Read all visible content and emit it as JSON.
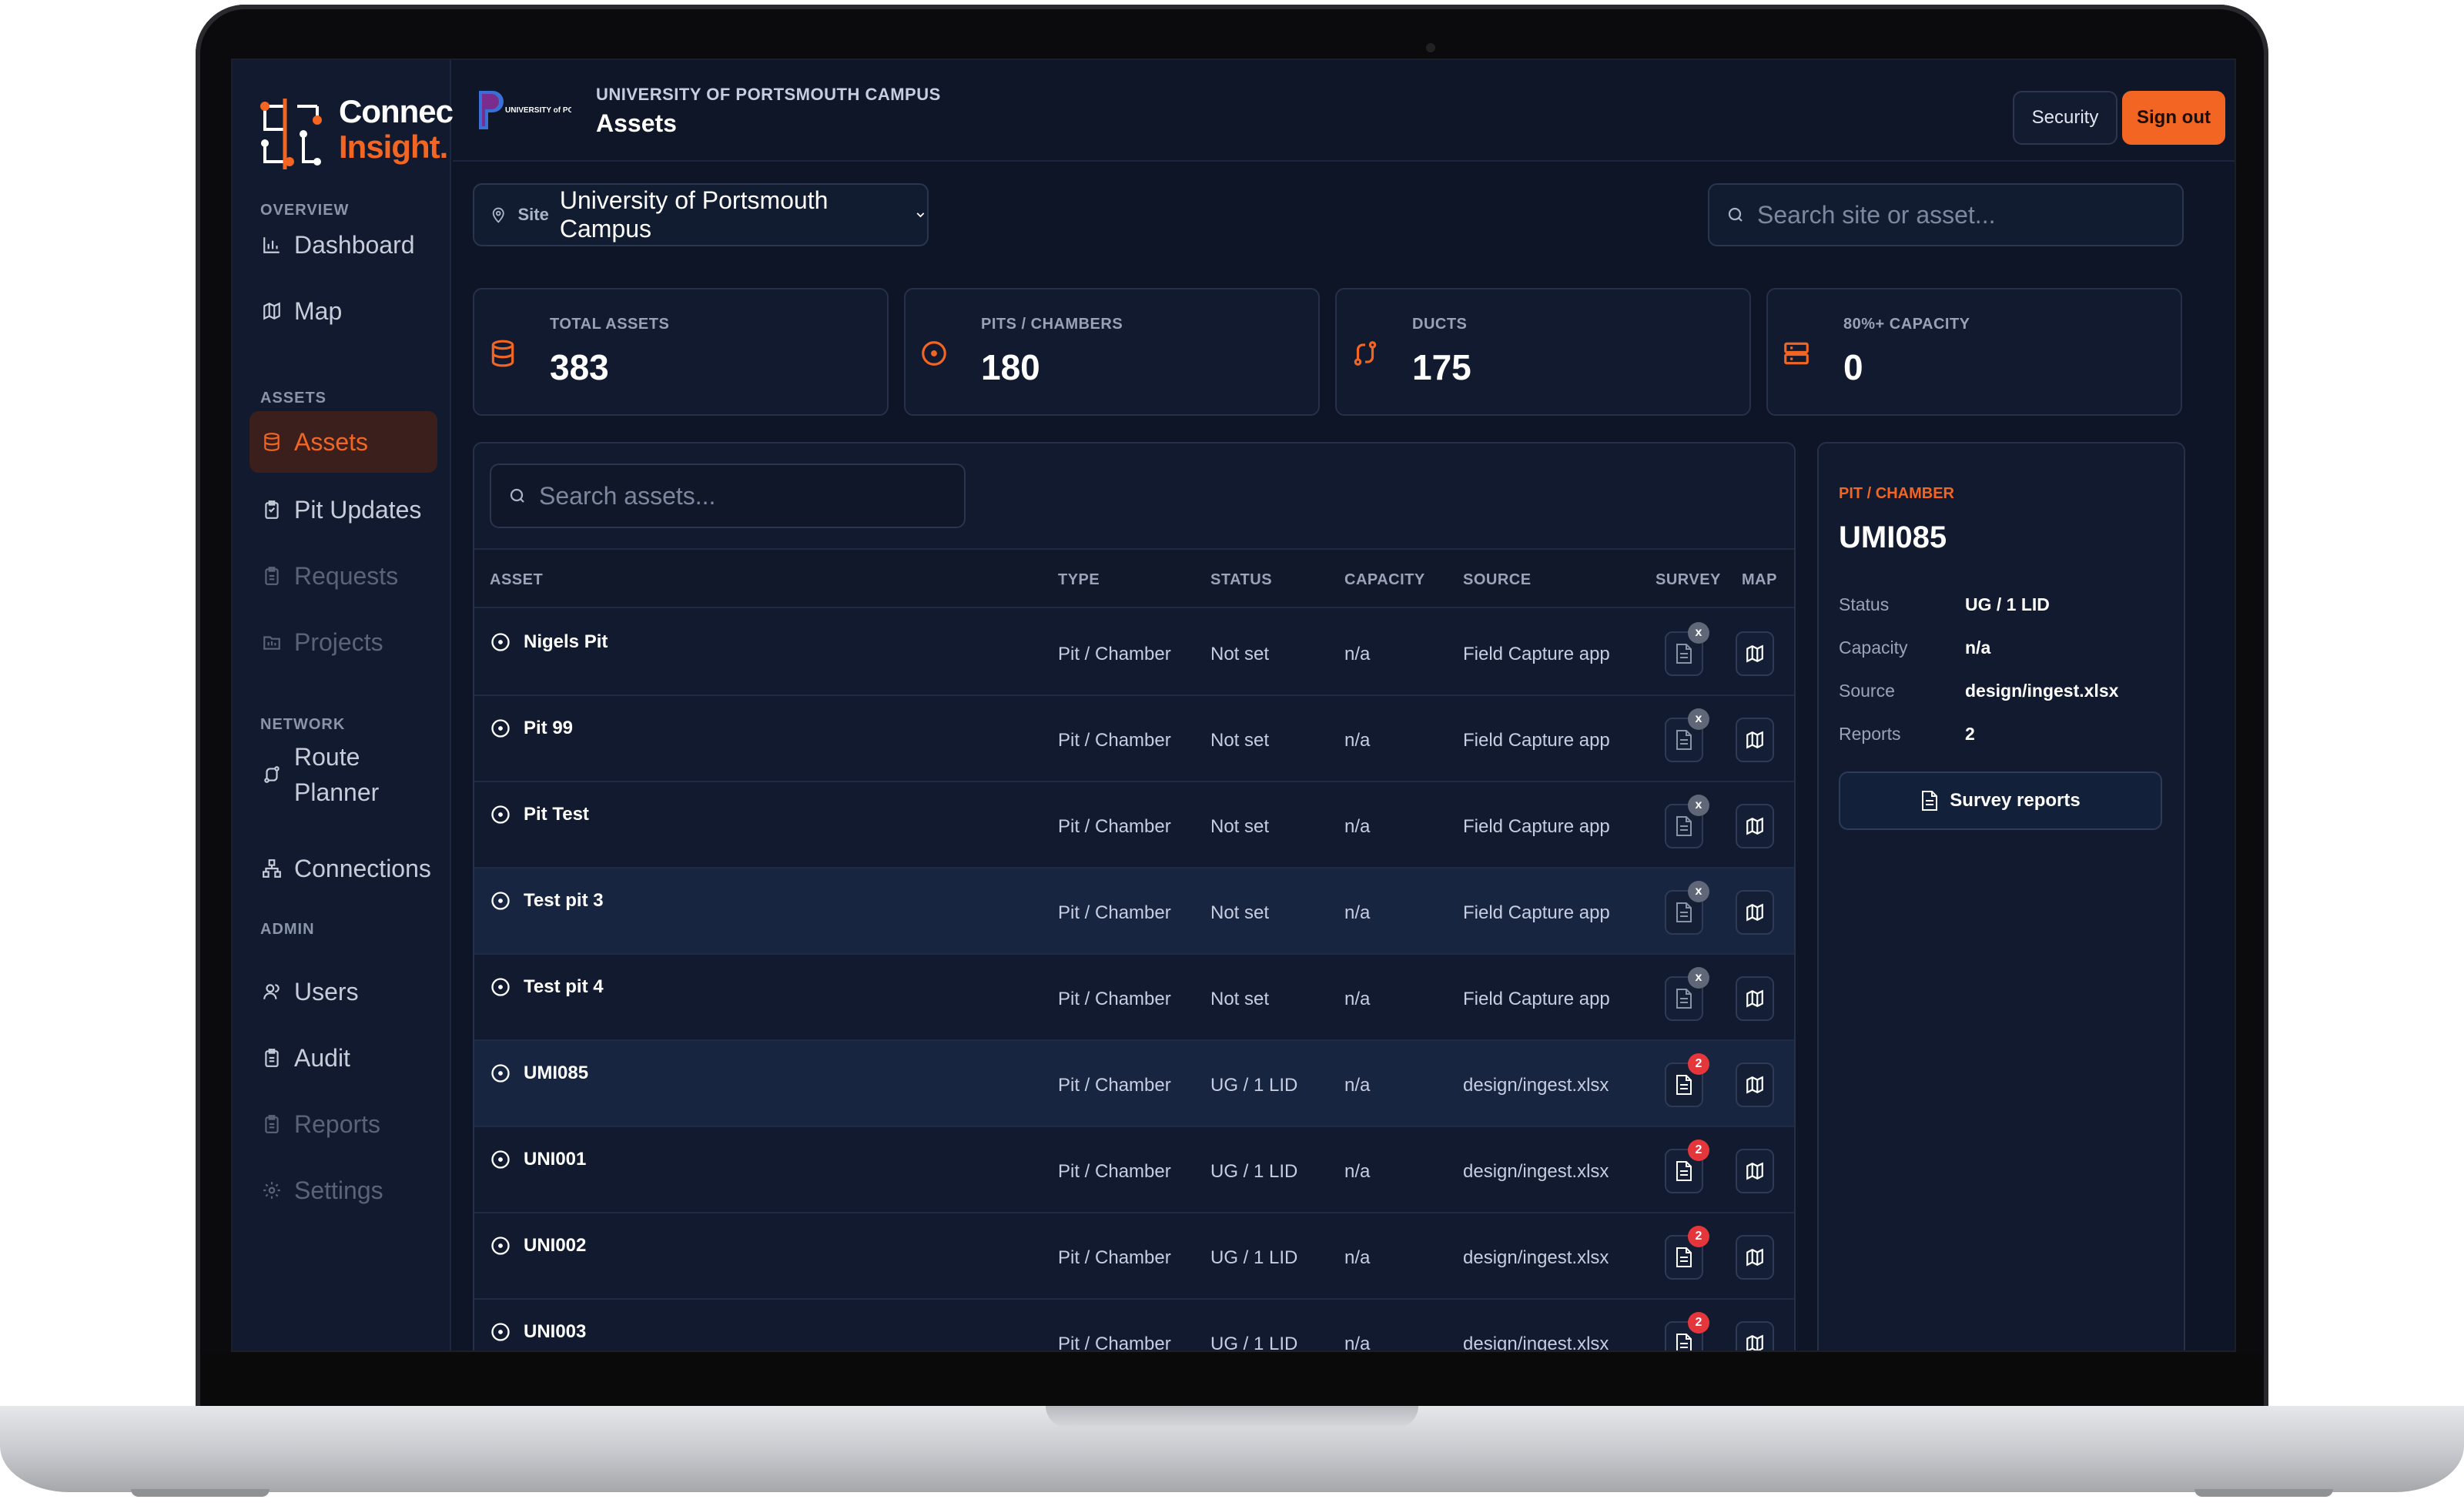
{
  "brand": {
    "line1": "Connect",
    "line2": "Insight."
  },
  "sidebar": {
    "sections": [
      "OVERVIEW",
      "ASSETS",
      "NETWORK",
      "ADMIN"
    ],
    "items": [
      {
        "label": "Dashboard",
        "icon": "bar-chart-icon"
      },
      {
        "label": "Map",
        "icon": "map-icon"
      },
      {
        "label": "Assets",
        "icon": "database-icon"
      },
      {
        "label": "Pit Updates",
        "icon": "clipboard-icon"
      },
      {
        "label": "Requests",
        "icon": "clipboard-icon"
      },
      {
        "label": "Projects",
        "icon": "folder-icon"
      },
      {
        "label": "Route",
        "label2": "Planner",
        "icon": "route-icon"
      },
      {
        "label": "Connections",
        "icon": "network-icon"
      },
      {
        "label": "Users",
        "icon": "user-icon"
      },
      {
        "label": "Audit",
        "icon": "clipboard-icon"
      },
      {
        "label": "Reports",
        "icon": "clipboard-icon"
      },
      {
        "label": "Settings",
        "icon": "gear-icon"
      }
    ]
  },
  "header": {
    "org_logo_text": "UNIVERSITY of PORTSMOUTH",
    "campus": "UNIVERSITY OF PORTSMOUTH CAMPUS",
    "title": "Assets",
    "security_label": "Security",
    "signout_label": "Sign out"
  },
  "filters": {
    "site_label": "Site",
    "site_value": "University of Portsmouth Campus",
    "search_placeholder": "Search site or asset..."
  },
  "stats": [
    {
      "label": "TOTAL ASSETS",
      "value": "383"
    },
    {
      "label": "PITS / CHAMBERS",
      "value": "180"
    },
    {
      "label": "DUCTS",
      "value": "175"
    },
    {
      "label": "80%+ CAPACITY",
      "value": "0"
    }
  ],
  "table": {
    "search_placeholder": "Search assets...",
    "columns": [
      "ASSET",
      "TYPE",
      "STATUS",
      "CAPACITY",
      "SOURCE",
      "SURVEY",
      "MAP"
    ],
    "rows": [
      {
        "asset": "Nigels Pit",
        "type": "Pit / Chamber",
        "status": "Not set",
        "capacity": "n/a",
        "source": "Field Capture app",
        "badge": "x"
      },
      {
        "asset": "Pit 99",
        "type": "Pit / Chamber",
        "status": "Not set",
        "capacity": "n/a",
        "source": "Field Capture app",
        "badge": "x"
      },
      {
        "asset": "Pit Test",
        "type": "Pit / Chamber",
        "status": "Not set",
        "capacity": "n/a",
        "source": "Field Capture app",
        "badge": "x"
      },
      {
        "asset": "Test pit 3",
        "type": "Pit / Chamber",
        "status": "Not set",
        "capacity": "n/a",
        "source": "Field Capture app",
        "badge": "x"
      },
      {
        "asset": "Test pit 4",
        "type": "Pit / Chamber",
        "status": "Not set",
        "capacity": "n/a",
        "source": "Field Capture app",
        "badge": "x"
      },
      {
        "asset": "UMI085",
        "type": "Pit / Chamber",
        "status": "UG / 1 LID",
        "capacity": "n/a",
        "source": "design/ingest.xlsx",
        "badge": "2"
      },
      {
        "asset": "UNI001",
        "type": "Pit / Chamber",
        "status": "UG / 1 LID",
        "capacity": "n/a",
        "source": "design/ingest.xlsx",
        "badge": "2"
      },
      {
        "asset": "UNI002",
        "type": "Pit / Chamber",
        "status": "UG / 1 LID",
        "capacity": "n/a",
        "source": "design/ingest.xlsx",
        "badge": "2"
      },
      {
        "asset": "UNI003",
        "type": "Pit / Chamber",
        "status": "UG / 1 LID",
        "capacity": "n/a",
        "source": "design/ingest.xlsx",
        "badge": "2"
      }
    ]
  },
  "detail": {
    "kind": "PIT / CHAMBER",
    "title": "UMI085",
    "fields": [
      {
        "key": "Status",
        "value": "UG / 1 LID"
      },
      {
        "key": "Capacity",
        "value": "n/a"
      },
      {
        "key": "Source",
        "value": "design/ingest.xlsx"
      },
      {
        "key": "Reports",
        "value": "2"
      }
    ],
    "button_label": "Survey reports"
  },
  "colors": {
    "accent": "#f26522",
    "background": "#0d1526",
    "panel": "#111a2e",
    "badge_red": "#e5373b"
  }
}
